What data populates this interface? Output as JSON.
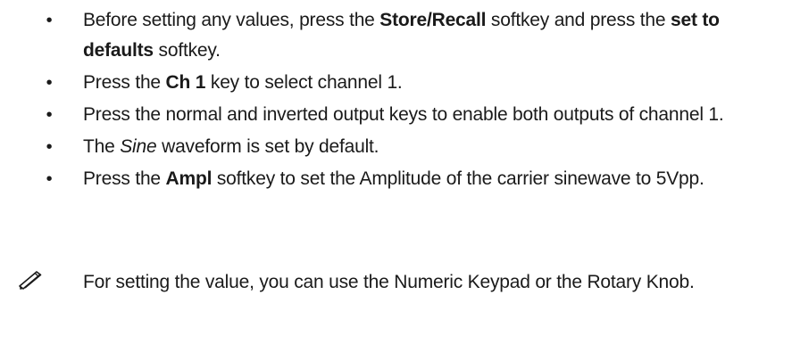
{
  "bullet_char": "•",
  "bullets": [
    {
      "parts": [
        {
          "text": "Before setting any values, press the ",
          "style": "normal"
        },
        {
          "text": "Store/Recall",
          "style": "bold"
        },
        {
          "text": " softkey and press the ",
          "style": "normal"
        },
        {
          "text": "set to defaults",
          "style": "bold"
        },
        {
          "text": " softkey.",
          "style": "normal"
        }
      ]
    },
    {
      "parts": [
        {
          "text": "Press the ",
          "style": "normal"
        },
        {
          "text": "Ch 1",
          "style": "bold"
        },
        {
          "text": " key to select channel 1.",
          "style": "normal"
        }
      ]
    },
    {
      "parts": [
        {
          "text": "Press the normal and inverted output keys to enable both outputs of channel 1.",
          "style": "normal"
        }
      ]
    },
    {
      "parts": [
        {
          "text": "The ",
          "style": "normal"
        },
        {
          "text": "Sine",
          "style": "italic"
        },
        {
          "text": " waveform is set by default.",
          "style": "normal"
        }
      ]
    },
    {
      "parts": [
        {
          "text": "Press the ",
          "style": "normal"
        },
        {
          "text": "Ampl",
          "style": "bold"
        },
        {
          "text": " softkey to set the Amplitude of the carrier sinewave to 5Vpp.",
          "style": "normal"
        }
      ]
    }
  ],
  "note": {
    "icon": "pencil-note-icon",
    "text": "For setting the value, you can use the Numeric Keypad or the Rotary Knob."
  }
}
